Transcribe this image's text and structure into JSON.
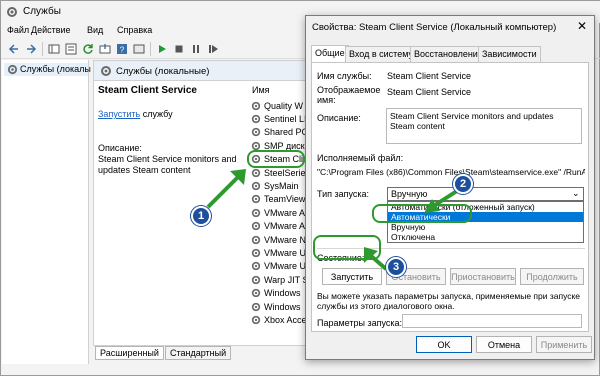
{
  "window": {
    "title": "Службы"
  },
  "menu": [
    "Файл",
    "Действие",
    "Вид",
    "Справка"
  ],
  "tree": {
    "item": "Службы (локалы"
  },
  "content": {
    "header": "Службы (локальные)",
    "service_title": "Steam Client Service",
    "start_link": "Запустить",
    "start_suffix": " службу",
    "desc_label": "Описание:",
    "desc_text": "Steam Client Service monitors and updates Steam content",
    "list_header": "Имя",
    "services": [
      "Quality W",
      "Sentinel LI",
      "Shared PC",
      "SMP диск",
      "Steam Clie",
      "SteelSeries",
      "SysMain",
      "TeamView",
      "VMware A",
      "VMware A",
      "VMware N",
      "VMware U",
      "VMware U",
      "Warp JIT S",
      "Windows",
      "Windows",
      "Xbox Acce"
    ]
  },
  "bottom_tabs": [
    "Расширенный",
    "Стандартный"
  ],
  "dialog": {
    "title": "Свойства: Steam Client Service (Локальный компьютер)",
    "close": "✕",
    "tabs": [
      "Общие",
      "Вход в систему",
      "Восстановление",
      "Зависимости"
    ],
    "fields": {
      "service_name_label": "Имя службы:",
      "service_name": "Steam Client Service",
      "display_name_label": "Отображаемое имя:",
      "display_name": "Steam Client Service",
      "description_label": "Описание:",
      "description": "Steam Client Service monitors and updates Steam content",
      "exe_label": "Исполняемый файл:",
      "exe_path": "\"C:\\Program Files (x86)\\Common Files\\Steam\\steamservice.exe\" /RunAsSe",
      "startup_label": "Тип запуска:",
      "startup_value": "Вручную",
      "startup_options": [
        "Автоматически (отложенный запуск)",
        "Автоматически",
        "Вручную",
        "Отключена"
      ],
      "selected_option": "Автоматически",
      "state_label": "Состояние:",
      "hint": "Вы можете указать параметры запуска, применяемые при запуске службы из этого диалогового окна.",
      "params_label": "Параметры запуска:"
    },
    "buttons": {
      "start": "Запустить",
      "stop": "Остановить",
      "pause": "Приостановить",
      "resume": "Продолжить",
      "ok": "OK",
      "cancel": "Отмена",
      "apply": "Применить"
    }
  },
  "annotations": [
    "1",
    "2",
    "3"
  ],
  "colors": {
    "highlight": "#2e9a2e",
    "badge": "#1e4f9c",
    "selection": "#0078d7"
  }
}
